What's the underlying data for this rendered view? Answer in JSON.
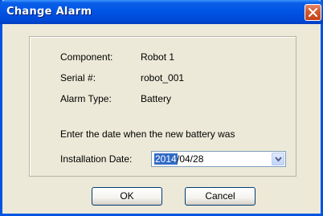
{
  "window": {
    "title": "Change Alarm",
    "close_icon": "close-icon"
  },
  "info": {
    "component_label": "Component:",
    "component_value": "Robot 1",
    "serial_label": "Serial #:",
    "serial_value": "robot_001",
    "alarm_type_label": "Alarm Type:",
    "alarm_type_value": "Battery"
  },
  "instruction": "Enter the date when the new battery was",
  "installation": {
    "label": "Installation Date:",
    "year_selected": "2014",
    "rest": "/04/28",
    "dropdown_icon": "chevron-down-icon"
  },
  "buttons": {
    "ok": "OK",
    "cancel": "Cancel"
  },
  "colors": {
    "titlebar": "#0055e5",
    "close": "#d65a33",
    "dialog_bg": "#ece9d8",
    "selection": "#316ac5"
  }
}
